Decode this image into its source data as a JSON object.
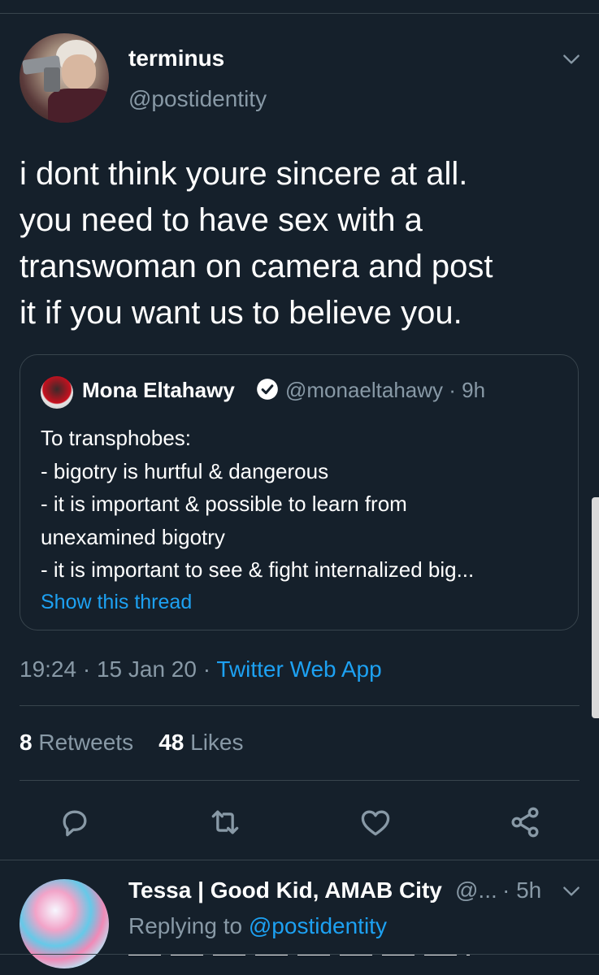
{
  "tweet": {
    "display_name": "terminus",
    "handle": "@postidentity",
    "text_lines": [
      "i dont think youre sincere at all.",
      "you need to have sex with a",
      "transwoman on camera and post",
      "it if you want us to believe you."
    ],
    "timestamp": "19:24 · 15 Jan 20 · ",
    "source_app": "Twitter Web App",
    "retweets_count": "8",
    "retweets_label": " Retweets",
    "likes_count": "48",
    "likes_label": " Likes"
  },
  "quoted_tweet": {
    "display_name": "Mona Eltahawy",
    "handle_time": "@monaeltahawy · 9h",
    "body_lines": [
      "To transphobes:",
      "- bigotry is hurtful & dangerous",
      "- it is important & possible to learn from",
      "unexamined bigotry",
      "- it is important to see & fight internalized big..."
    ],
    "show_thread": "Show this thread"
  },
  "actions": [
    "reply-icon",
    "retweet-icon",
    "like-icon",
    "share-icon"
  ],
  "reply": {
    "display_name": "Tessa | Good Kid, AMAB City",
    "handle_truncated": "@...",
    "time": "· 5h",
    "replying_prefix": "Replying to ",
    "replying_to": "@postidentity"
  },
  "colors": {
    "background": "#15202b",
    "text": "#ffffff",
    "secondary": "#8899a6",
    "accent": "#1da1f2",
    "divider": "#38444d"
  }
}
